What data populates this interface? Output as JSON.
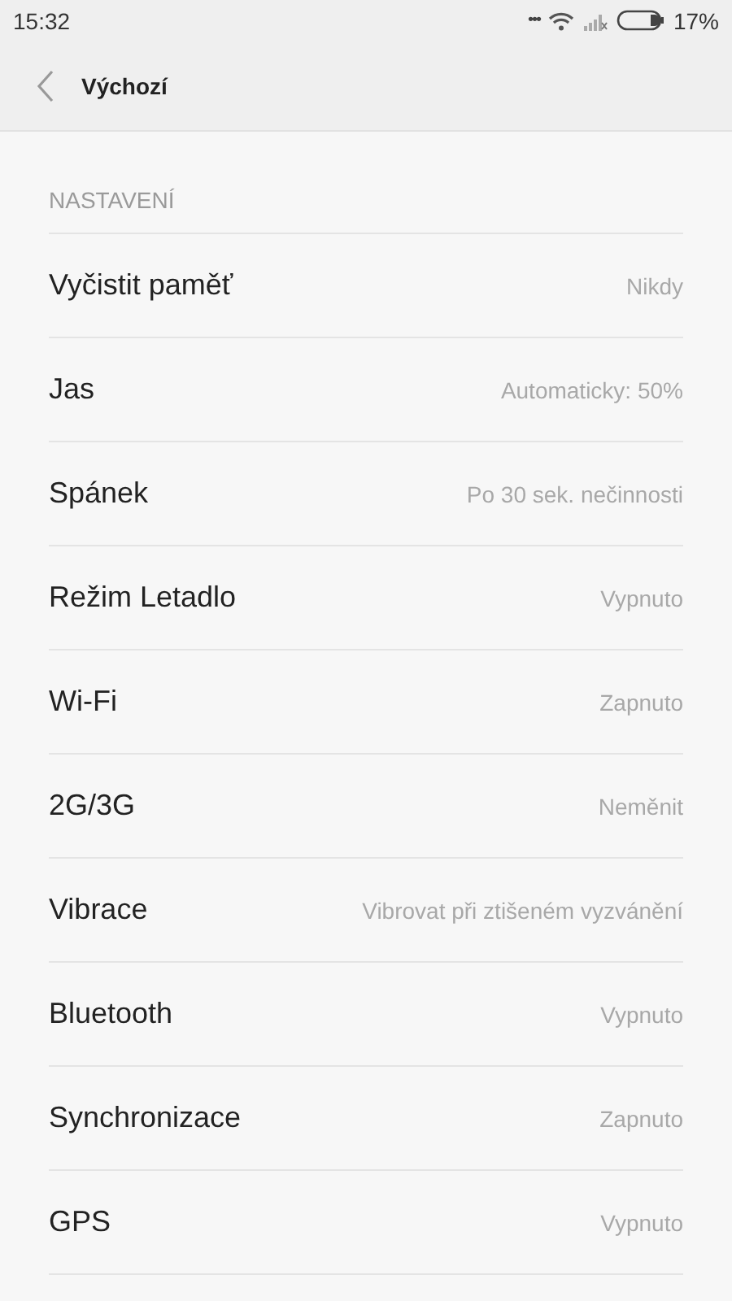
{
  "status_bar": {
    "time": "15:32",
    "more": "•••",
    "battery_text": "17%"
  },
  "header": {
    "title": "Výchozí"
  },
  "section": {
    "title": "NASTAVENÍ"
  },
  "rows": [
    {
      "label": "Vyčistit paměť",
      "value": "Nikdy"
    },
    {
      "label": "Jas",
      "value": "Automaticky: 50%"
    },
    {
      "label": "Spánek",
      "value": "Po 30 sek. nečinnosti"
    },
    {
      "label": "Režim Letadlo",
      "value": "Vypnuto"
    },
    {
      "label": "Wi-Fi",
      "value": "Zapnuto"
    },
    {
      "label": "2G/3G",
      "value": "Neměnit"
    },
    {
      "label": "Vibrace",
      "value": "Vibrovat při ztišeném vyzvánění"
    },
    {
      "label": "Bluetooth",
      "value": "Vypnuto"
    },
    {
      "label": "Synchronizace",
      "value": "Zapnuto"
    },
    {
      "label": "GPS",
      "value": "Vypnuto"
    }
  ]
}
